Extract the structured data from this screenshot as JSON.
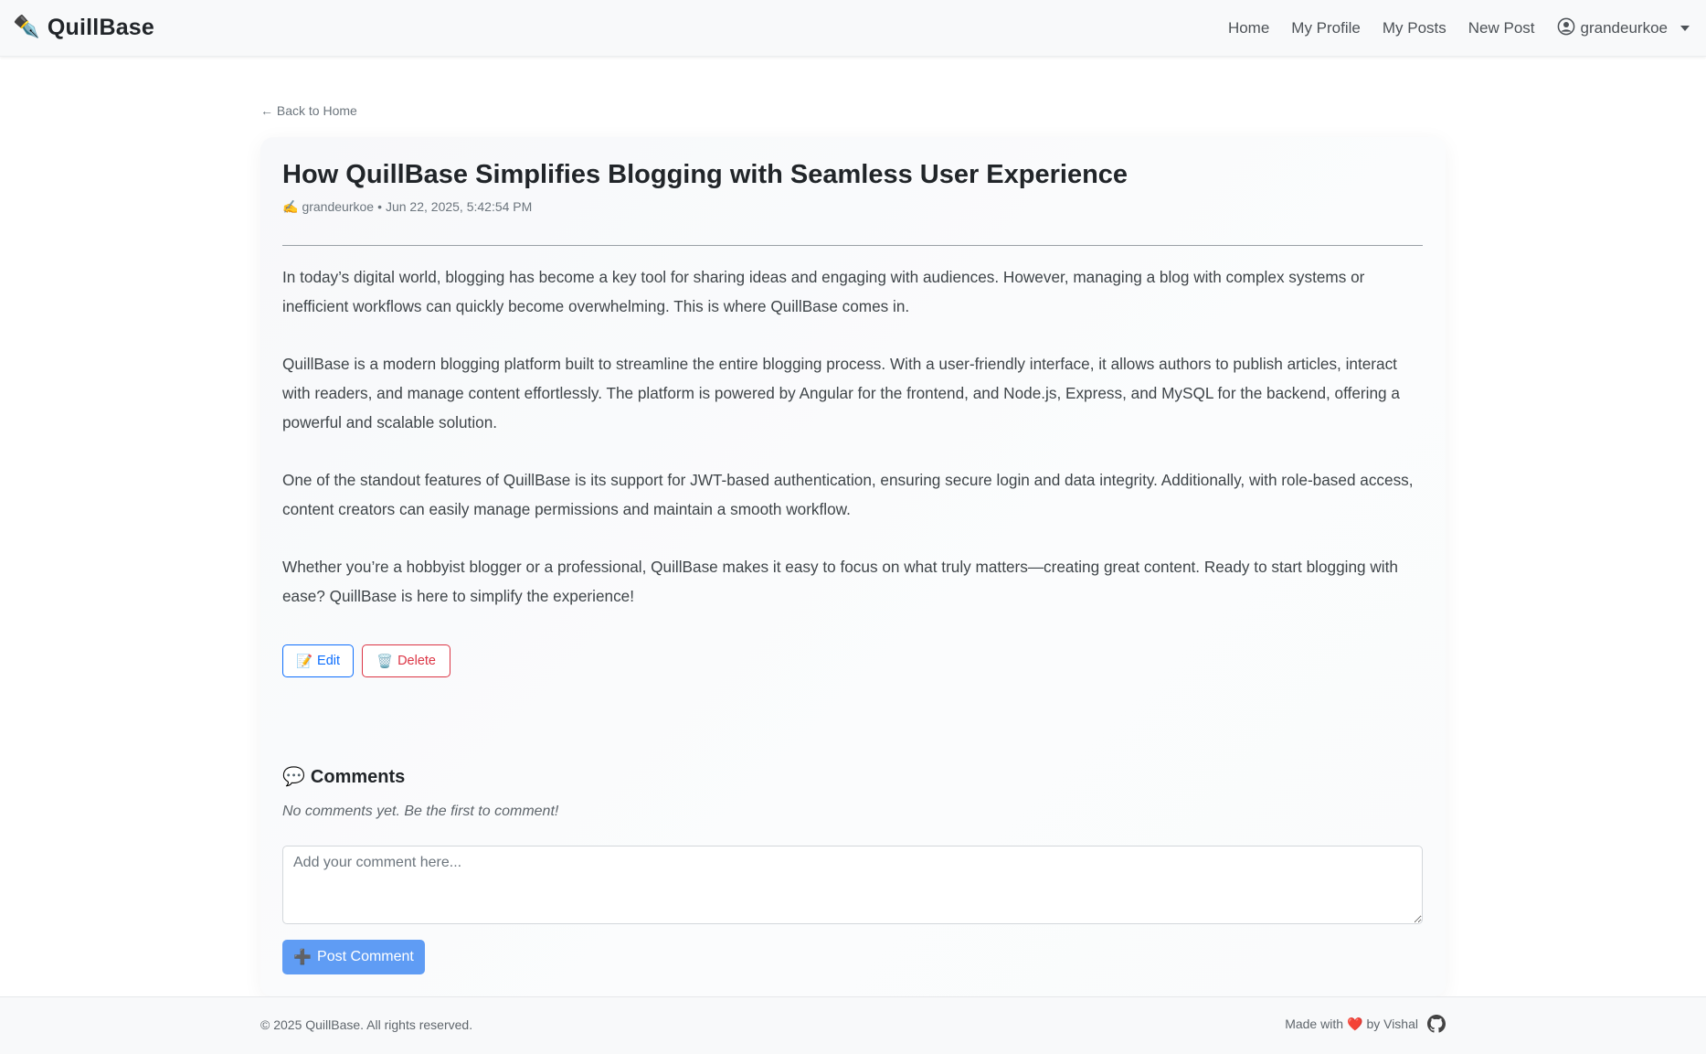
{
  "navbar": {
    "brand_icon": "✒️",
    "brand_name": "QuillBase",
    "links": {
      "home": "Home",
      "my_profile": "My Profile",
      "my_posts": "My Posts",
      "new_post": "New Post"
    },
    "user": {
      "icon": "person-circle-icon",
      "username": "grandeurkoe"
    }
  },
  "back_link": "← Back to Home",
  "post": {
    "title": "How QuillBase Simplifies Blogging with Seamless User Experience",
    "meta_icon": "✍️",
    "author": "grandeurkoe",
    "separator": "•",
    "date": "Jun 22, 2025, 5:42:54 PM",
    "paragraphs": [
      "In today’s digital world, blogging has become a key tool for sharing ideas and engaging with audiences. However, managing a blog with complex systems or inefficient workflows can quickly become overwhelming. This is where QuillBase comes in.",
      "QuillBase is a modern blogging platform built to streamline the entire blogging process. With a user-friendly interface, it allows authors to publish articles, interact with readers, and manage content effortlessly. The platform is powered by Angular for the frontend, and Node.js, Express, and MySQL for the backend, offering a powerful and scalable solution.",
      "One of the standout features of QuillBase is its support for JWT-based authentication, ensuring secure login and data integrity. Additionally, with role-based access, content creators can easily manage permissions and maintain a smooth workflow.",
      "Whether you’re a hobbyist blogger or a professional, QuillBase makes it easy to focus on what truly matters—creating great content. Ready to start blogging with ease? QuillBase is here to simplify the experience!"
    ],
    "edit_icon": "📝",
    "edit_label": "Edit",
    "delete_icon": "🗑️",
    "delete_label": "Delete"
  },
  "comments": {
    "icon": "💬",
    "heading": "Comments",
    "empty_text": "No comments yet. Be the first to comment!",
    "input_placeholder": "Add your comment here...",
    "post_icon": "➕",
    "post_label": "Post Comment"
  },
  "footer": {
    "copyright": "© 2025 QuillBase. All rights reserved.",
    "made_with": "Made with",
    "heart": "❤️",
    "by": "by Vishal",
    "github_icon": "github-icon"
  },
  "colors": {
    "primary": "#0d6efd",
    "danger": "#dc3545",
    "post_button": "#5f9cf4",
    "navbar_bg": "#f8f9fa"
  }
}
